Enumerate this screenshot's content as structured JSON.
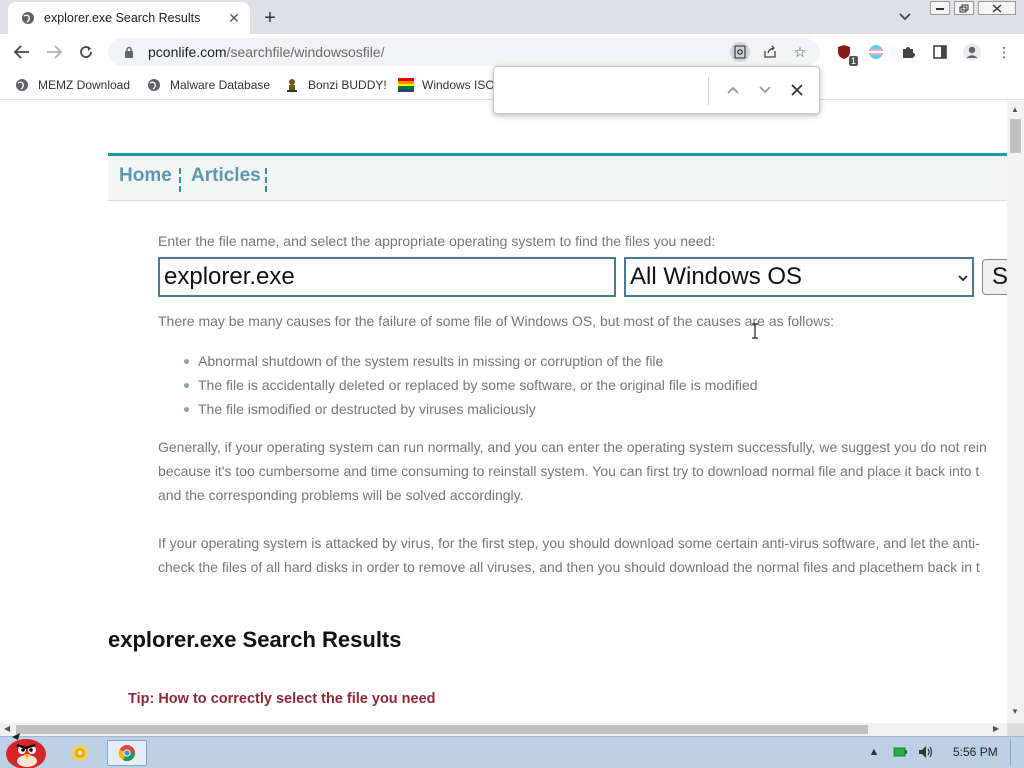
{
  "browser": {
    "tab": {
      "title": "explorer.exe Search Results",
      "favicon": "globe-icon",
      "close_icon": "close-icon"
    },
    "new_tab_icon": "plus-icon",
    "tab_search_icon": "chevron-down-icon",
    "window_controls": [
      "minimize-icon",
      "restore-icon",
      "close-icon"
    ],
    "address": {
      "host": "pconlife.com",
      "path": "/searchfile/windowsosfile/",
      "lock_icon": "lock-icon"
    },
    "omnibox_icons": [
      "find-in-page-icon",
      "share-icon",
      "star-icon"
    ],
    "extension_badge": "1",
    "bookmarks": [
      {
        "label": "MEMZ Download",
        "icon": "globe-icon"
      },
      {
        "label": "Malware Database",
        "icon": "globe-icon"
      },
      {
        "label": "Bonzi BUDDY!",
        "icon": "bonzi-icon"
      },
      {
        "label": "Windows ISO",
        "icon": "windows-flag-icon"
      }
    ]
  },
  "find_bar": {
    "query": "",
    "icons": [
      "chevron-up-icon",
      "chevron-down-icon",
      "close-icon"
    ]
  },
  "page": {
    "nav": {
      "home": "Home",
      "articles": "Articles"
    },
    "intro": "Enter the file name, and select the appropriate operating system to find the files you need:",
    "search": {
      "value": "explorer.exe",
      "os_selected": "All Windows OS",
      "button_label": "Search"
    },
    "causes_intro": "There may be many causes for the failure of some file of Windows OS, but most of the causes are as follows:",
    "causes": [
      "Abnormal shutdown of the system results in missing or corruption of the file",
      "The file is accidentally deleted or replaced by some software, or the original file is modified",
      "The file ismodified or destructed by viruses maliciously"
    ],
    "para_generally": [
      "Generally, if your operating system can run normally, and you can enter the operating system successfully, we suggest you do not rein",
      "because it's too cumbersome and time consuming to reinstall system. You can first try to download normal file and place it back into t",
      "and the corresponding problems will be solved accordingly."
    ],
    "para_virus": [
      "If your operating system is attacked by virus, for the first step, you should download some certain anti-virus software, and let the anti-",
      "check the files of all hard disks in order to remove all viruses, and then you should download the normal files and placethem back in t"
    ],
    "results_title": "explorer.exe Search Results",
    "tip": "Tip: How to correctly select the file you need"
  },
  "taskbar": {
    "start_icon": "angry-bird-start-icon",
    "items": [
      "folder-icon",
      "chrome-icon"
    ],
    "tray_icons": [
      "up-arrow-icon",
      "battery-icon",
      "speaker-icon"
    ],
    "time": "5:56 PM"
  },
  "colors": {
    "accent_teal": "#1a9ca3",
    "nav_link": "#5a98b3",
    "tip_red": "#8b2a36",
    "body_text": "#777777",
    "taskbar": "#bdd1e6"
  }
}
